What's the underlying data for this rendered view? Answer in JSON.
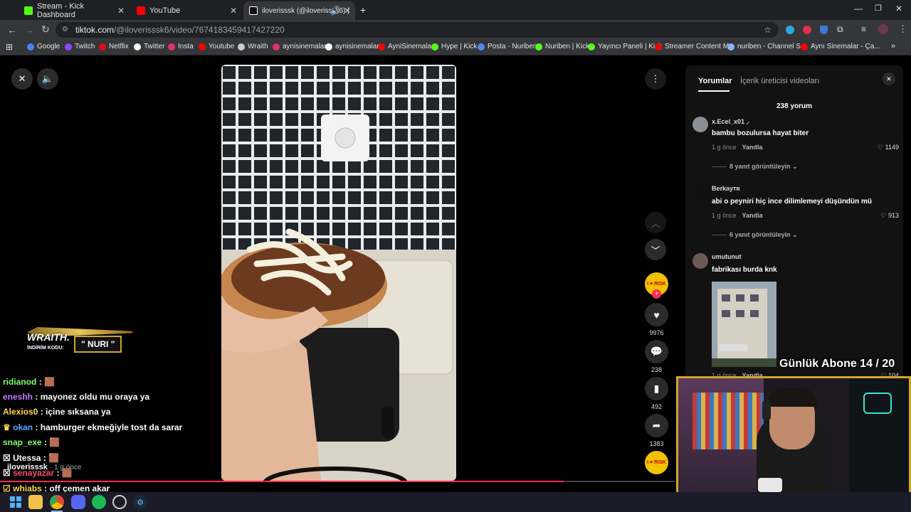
{
  "tabs": [
    {
      "label": "Stream - Kick Dashboard",
      "icon": "kick-icon",
      "color": "#53fc18"
    },
    {
      "label": "YouTube",
      "icon": "youtube-icon",
      "color": "#ff0000"
    },
    {
      "label": "iloverisssk (@iloverisssk6) |",
      "icon": "tiktok-icon",
      "color": "#ffffff"
    }
  ],
  "address": {
    "host": "tiktok.com",
    "path": "/@iloverisssk6/video/7674183459417427220"
  },
  "bookmarks": [
    {
      "label": "Google",
      "color": "#4285f4"
    },
    {
      "label": "Twitch",
      "color": "#9146ff"
    },
    {
      "label": "Netflix",
      "color": "#e50914"
    },
    {
      "label": "Twitter",
      "color": "#ffffff"
    },
    {
      "label": "Insta",
      "color": "#e1306c"
    },
    {
      "label": "Youtube",
      "color": "#ff0000"
    },
    {
      "label": "Wraith",
      "color": "#cccccc"
    },
    {
      "label": "aynisinemalar",
      "color": "#e1306c"
    },
    {
      "label": "aynisinemalar",
      "color": "#ffffff"
    },
    {
      "label": "AyniSinemalar",
      "color": "#ff0000"
    },
    {
      "label": "Hype | Kick",
      "color": "#53fc18"
    },
    {
      "label": "Posta - Nuriben",
      "color": "#4a8af4"
    },
    {
      "label": "Nuriben | Kick",
      "color": "#53fc18"
    },
    {
      "label": "Yayıncı Paneli | Kick",
      "color": "#53fc18"
    },
    {
      "label": "Streamer Content M...",
      "color": "#ff0000"
    },
    {
      "label": "nuriben - Channel S...",
      "color": "#8ab4f8"
    },
    {
      "label": "Aynı Sinemalar - Ça...",
      "color": "#ff0000"
    }
  ],
  "panel": {
    "tab_comments": "Yorumlar",
    "tab_creator": "İçerik üreticisi videoları",
    "count": "238 yorum",
    "comments": [
      {
        "user": "x.Ecel_x01 ⸝",
        "text": "bambu bozulursa hayat biter",
        "time": "1 g önce",
        "reply": "Yanıtla",
        "likes": "1149",
        "replies": "8 yanıt görüntüleyin ⌄"
      },
      {
        "user": "Berkayᴛʀ",
        "text": "abi o peyniri hiç ince dilimlemeyi düşündün mü",
        "time": "1 g önce",
        "reply": "Yanıtla",
        "likes": "913",
        "replies": "6 yanıt görüntüleyin ⌄"
      },
      {
        "user": "umutunut",
        "text": "fabrikası burda knk",
        "time": "1 g önce",
        "reply": "Yanıtla",
        "likes": "104"
      }
    ]
  },
  "actions": {
    "likes": "9976",
    "comments": "238",
    "saves": "492",
    "shares": "1383"
  },
  "sponsor": {
    "brand": "WRAITH.",
    "code_label": "İNDİRİM KODU:",
    "code": "\" NURI \""
  },
  "chat": [
    {
      "user": "ridianod",
      "msg": ": 🟫",
      "color": "#7cff6b"
    },
    {
      "user": "eneshh",
      "msg": ": mayonez oldu mu oraya ya",
      "color": "#c27bff"
    },
    {
      "user": "Alexios0",
      "msg": ": içine sıksana ya",
      "color": "#ffd84a"
    },
    {
      "user": "okan",
      "msg": ": hamburger ekmeğiyle tost da sarar",
      "color": "#5aa8ff"
    },
    {
      "user": "snap_exe",
      "msg": ": 🟫",
      "color": "#7cff6b"
    },
    {
      "user": "Utessa",
      "msg": ": 🟫",
      "color": "#ffffff"
    },
    {
      "user": "senayazar",
      "msg": ": 🟫",
      "color": "#ff4a6e"
    },
    {
      "user": "whiabs",
      "msg": ": off çemen akar",
      "color": "#ffd84a"
    }
  ],
  "video_author": {
    "name": "iloverisssk",
    "time": "· 1 g önce"
  },
  "overlay": {
    "subs": "Günlük Abone 14 / 20"
  }
}
